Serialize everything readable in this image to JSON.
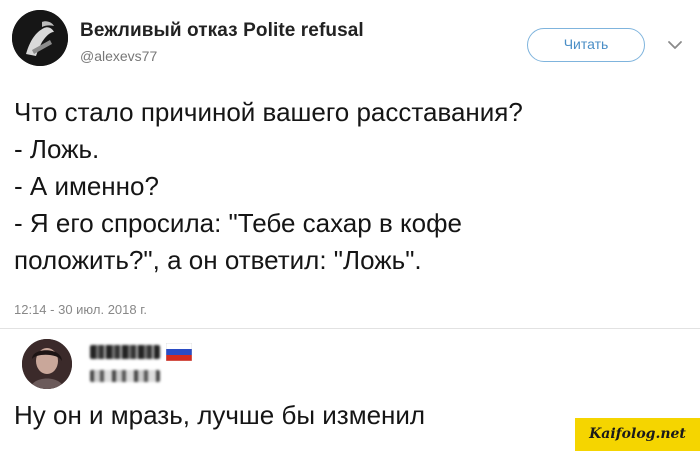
{
  "author": {
    "name": "Вежливый отказ Polite refusal",
    "handle": "@alexevs77"
  },
  "follow_button": {
    "label": "Читать",
    "color": "#4a8ec6"
  },
  "tweet": {
    "lines": [
      "Что стало причиной вашего расставания?",
      "- Ложь.",
      "- А именно?",
      "- Я его спросила: \"Тебе сахар в кофе",
      "положить?\", а он ответил: \"Ложь\"."
    ],
    "timestamp": "12:14 - 30 июл. 2018 г."
  },
  "reply": {
    "text": "Ну он и мразь, лучше бы изменил"
  },
  "watermark": {
    "text": "Kaifolog.net",
    "background": "#f5d500"
  },
  "icons": {
    "author_avatar": "avatar-icon",
    "more": "chevron-down-icon",
    "reply_avatar": "avatar-icon",
    "reply_flag": "flag-icon"
  }
}
